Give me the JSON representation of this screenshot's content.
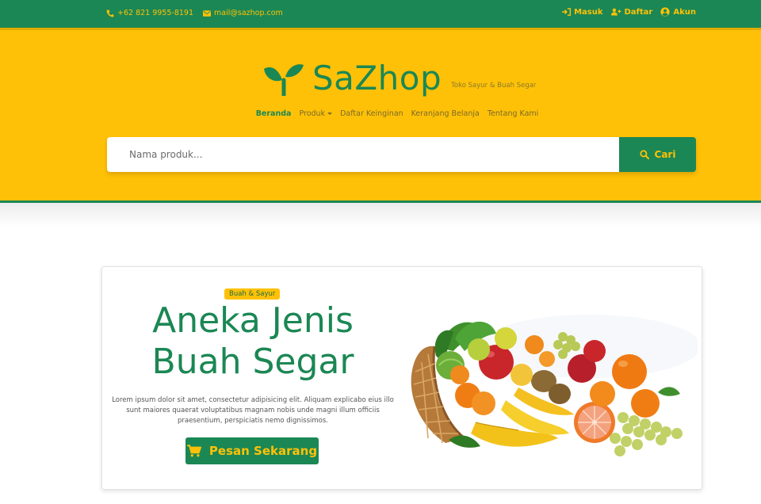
{
  "topbar": {
    "phone": "+62 821 9955-8191",
    "email": "mail@sazhop.com",
    "login": "Masuk",
    "register": "Daftar",
    "account": "Akun"
  },
  "brand": {
    "name": "SaZhop",
    "tagline": "Toko Sayur & Buah Segar"
  },
  "nav": {
    "items": [
      "Beranda",
      "Produk",
      "Daftar Keinginan",
      "Keranjang Belanja",
      "Tentang Kami"
    ]
  },
  "search": {
    "placeholder": "Nama produk...",
    "button": "Cari"
  },
  "hero": {
    "badge": "Buah & Sayur",
    "title_line1": "Aneka Jenis",
    "title_line2": "Buah Segar",
    "description": "Lorem ipsum dolor sit amet, consectetur adipisicing elit. Aliquam explicabo eius illo sunt maiores quaerat voluptatibus magnam nobis unde magni illum officiis praesentium, perspiciatis nemo dignissimos.",
    "button": "Pesan Sekarang"
  },
  "colors": {
    "primary": "#1b8754",
    "accent": "#ffc107"
  },
  "icons": [
    "phone-icon",
    "envelope-icon",
    "sign-in-icon",
    "user-plus-icon",
    "user-circle-icon",
    "sprout-logo-icon",
    "search-icon",
    "shopping-cart-icon"
  ]
}
